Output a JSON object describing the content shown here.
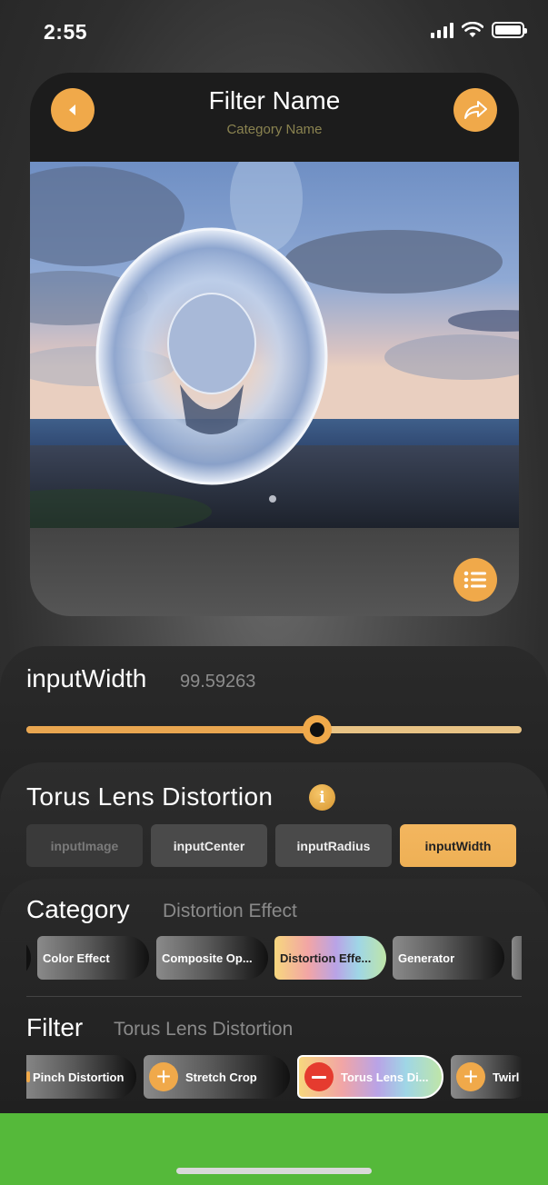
{
  "status_bar": {
    "time": "2:55",
    "icons": [
      "signal-icon",
      "wifi-icon",
      "battery-icon"
    ]
  },
  "preview": {
    "filter_name": "Filter Name",
    "category_name": "Category Name",
    "icons": {
      "back": "back-arrow-icon",
      "share": "share-icon",
      "menu": "list-icon"
    }
  },
  "parameter": {
    "name": "inputWidth",
    "value": "99.59263",
    "slider_fraction": 0.587
  },
  "filter_info": {
    "title": "Torus Lens Distortion",
    "info_icon": "i",
    "inputs": [
      {
        "label": "inputImage",
        "state": "disabled"
      },
      {
        "label": "inputCenter",
        "state": "normal"
      },
      {
        "label": "inputRadius",
        "state": "normal"
      },
      {
        "label": "inputWidth",
        "state": "selected"
      }
    ]
  },
  "category": {
    "label": "Category",
    "value": "Distortion Effect",
    "chips": [
      {
        "label": "Color Effect"
      },
      {
        "label": "Composite Op..."
      },
      {
        "label": "Distortion Effe...",
        "selected": true
      },
      {
        "label": "Generator"
      }
    ]
  },
  "filter": {
    "label": "Filter",
    "value": "Torus Lens Distortion",
    "chips": [
      {
        "label": "Pinch Distortion"
      },
      {
        "label": "Stretch Crop",
        "action": "+"
      },
      {
        "label": "Torus Lens Di...",
        "action": "-",
        "selected": true
      },
      {
        "label": "Twirl",
        "action": "+"
      }
    ]
  },
  "colors": {
    "accent": "#f0a94a",
    "remove": "#e53b2f",
    "bottom_bar": "#55b93a"
  }
}
